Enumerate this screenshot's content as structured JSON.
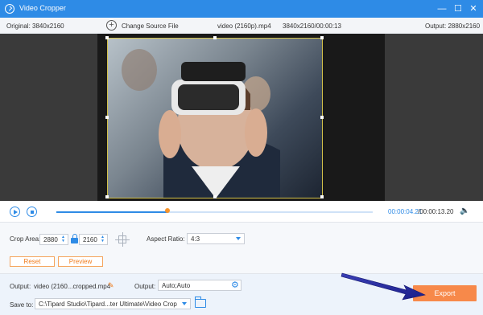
{
  "window": {
    "title": "Video Cropper",
    "minimize_glyph": "—",
    "maximize_glyph": "☐",
    "close_glyph": "✕"
  },
  "infobar": {
    "original": "Original: 3840x2160",
    "change_source": "Change Source File",
    "file_name": "video (2160p).mp4",
    "file_resolution": "3840x2160/00:00:13",
    "output": "Output: 2880x2160"
  },
  "player": {
    "time_current": "00:00:04.21",
    "time_total": "/00:00:13.20",
    "progress": 0.35
  },
  "crop": {
    "label": "Crop Area:",
    "width": "2880",
    "height": "2160",
    "aspect_label": "Aspect Ratio:",
    "aspect_value": "4:3",
    "reset": "Reset",
    "preview": "Preview"
  },
  "bottom": {
    "output_label": "Output:",
    "output_name": "video (2160...cropped.mp4",
    "output_settings_label": "Output:",
    "output_settings_value": "Auto;Auto",
    "save_to_label": "Save to:",
    "save_path": "C:\\Tipard Studio\\Tipard...ter Ultimate\\Video Crop",
    "export": "Export"
  },
  "colors": {
    "accent": "#2e8be6",
    "export": "#f7894a",
    "playhead": "#f7942b",
    "crop_border": "#d4c24a"
  },
  "icons": [
    "app-icon",
    "minimize-icon",
    "maximize-icon",
    "close-icon",
    "plus-icon",
    "play-icon",
    "stop-icon",
    "volume-icon",
    "lock-icon",
    "center-icon",
    "edit-icon",
    "gear-icon",
    "folder-icon"
  ]
}
